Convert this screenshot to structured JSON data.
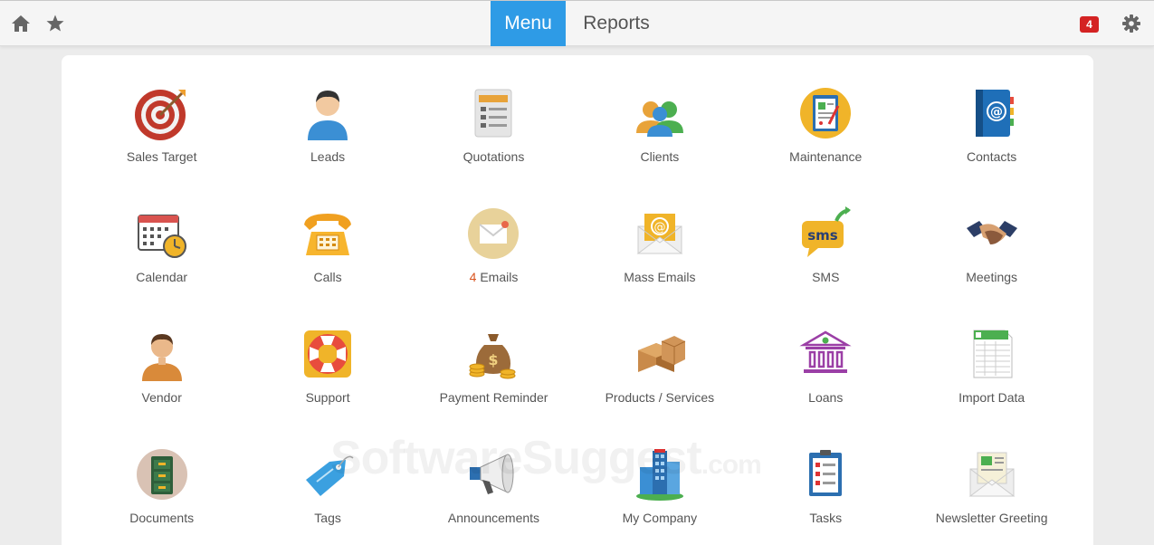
{
  "topbar": {
    "tabs": [
      {
        "label": "Menu",
        "active": true
      },
      {
        "label": "Reports",
        "active": false
      }
    ],
    "notification_count": "4",
    "accent_color": "#2e9be6",
    "badge_color": "#d42323",
    "icons": [
      "home-icon",
      "star-icon",
      "gear-icon"
    ]
  },
  "menu": {
    "items": [
      {
        "label": "Sales Target",
        "icon": "target-icon"
      },
      {
        "label": "Leads",
        "icon": "person-icon"
      },
      {
        "label": "Quotations",
        "icon": "quote-document-icon"
      },
      {
        "label": "Clients",
        "icon": "people-group-icon"
      },
      {
        "label": "Maintenance",
        "icon": "clipboard-icon"
      },
      {
        "label": "Contacts",
        "icon": "address-book-icon"
      },
      {
        "label": "Calendar",
        "icon": "calendar-clock-icon"
      },
      {
        "label": "Calls",
        "icon": "telephone-icon"
      },
      {
        "label": "Emails",
        "count": "4",
        "icon": "envelope-icon"
      },
      {
        "label": "Mass Emails",
        "icon": "at-envelope-icon"
      },
      {
        "label": "SMS",
        "icon": "sms-bubble-icon"
      },
      {
        "label": "Meetings",
        "icon": "handshake-icon"
      },
      {
        "label": "Vendor",
        "icon": "vendor-person-icon"
      },
      {
        "label": "Support",
        "icon": "lifebuoy-icon"
      },
      {
        "label": "Payment Reminder",
        "icon": "money-bag-icon"
      },
      {
        "label": "Products / Services",
        "icon": "boxes-icon"
      },
      {
        "label": "Loans",
        "icon": "bank-icon"
      },
      {
        "label": "Import Data",
        "icon": "spreadsheet-icon"
      },
      {
        "label": "Documents",
        "icon": "filing-cabinet-icon"
      },
      {
        "label": "Tags",
        "icon": "tag-icon"
      },
      {
        "label": "Announcements",
        "icon": "megaphone-icon"
      },
      {
        "label": "My Company",
        "icon": "buildings-icon"
      },
      {
        "label": "Tasks",
        "icon": "task-list-icon"
      },
      {
        "label": "Newsletter Greeting",
        "icon": "newsletter-envelope-icon"
      }
    ]
  },
  "watermark": {
    "text": "SoftwareSuggest",
    "suffix": ".com"
  }
}
